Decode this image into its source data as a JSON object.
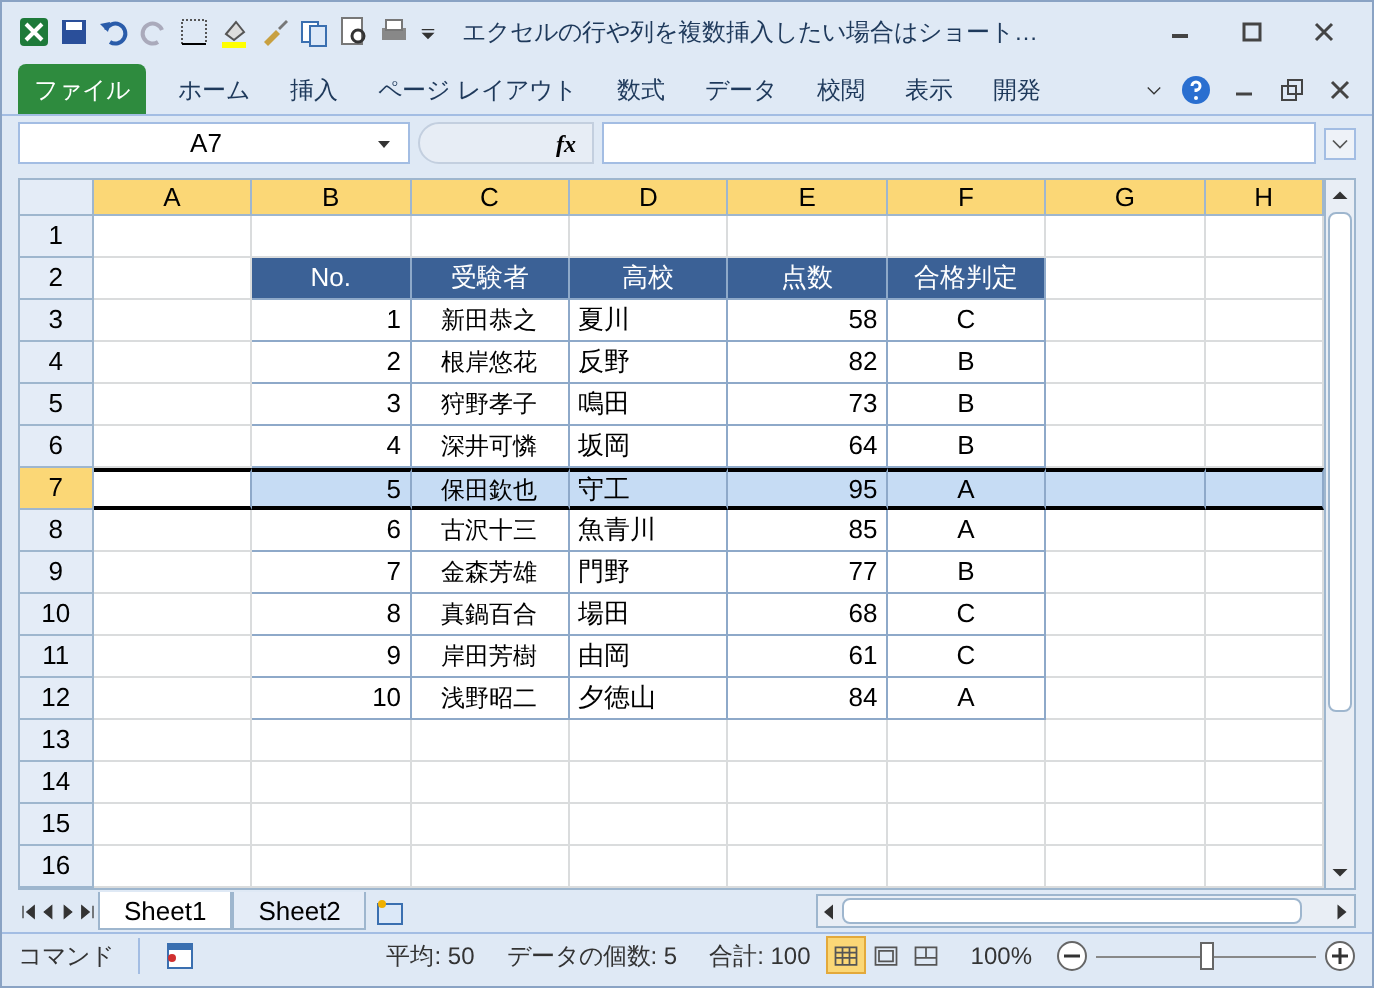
{
  "window": {
    "title": "エクセルの行や列を複数挿入したい場合はショート…"
  },
  "ribbon_tabs": [
    {
      "label": "ファイル",
      "kind": "file",
      "selected": false
    },
    {
      "label": "ホーム",
      "kind": "tab",
      "selected": false
    },
    {
      "label": "挿入",
      "kind": "tab",
      "selected": false
    },
    {
      "label": "ページ レイアウト",
      "kind": "tab",
      "selected": false
    },
    {
      "label": "数式",
      "kind": "tab",
      "selected": false
    },
    {
      "label": "データ",
      "kind": "tab",
      "selected": false
    },
    {
      "label": "校閲",
      "kind": "tab",
      "selected": false
    },
    {
      "label": "表示",
      "kind": "tab",
      "selected": false
    },
    {
      "label": "開発",
      "kind": "tab",
      "selected": false
    }
  ],
  "formula_bar": {
    "name_box": "A7",
    "function_label": "fx"
  },
  "columns": [
    {
      "label": "A",
      "selected": true
    },
    {
      "label": "B",
      "selected": true
    },
    {
      "label": "C",
      "selected": true
    },
    {
      "label": "D",
      "selected": true
    },
    {
      "label": "E",
      "selected": true
    },
    {
      "label": "F",
      "selected": true
    },
    {
      "label": "G",
      "selected": true
    },
    {
      "label": "H",
      "selected": true
    }
  ],
  "rows": [
    {
      "label": "1",
      "selected": false
    },
    {
      "label": "2",
      "selected": false,
      "kind": "header",
      "cells": [
        "No.",
        "受験者",
        "高校",
        "点数",
        "合格判定"
      ]
    },
    {
      "label": "3",
      "selected": false,
      "kind": "data",
      "cells": [
        "1",
        "新田恭之",
        "夏川",
        "58",
        "C"
      ]
    },
    {
      "label": "4",
      "selected": false,
      "kind": "data",
      "cells": [
        "2",
        "根岸悠花",
        "反野",
        "82",
        "B"
      ]
    },
    {
      "label": "5",
      "selected": false,
      "kind": "data",
      "cells": [
        "3",
        "狩野孝子",
        "鳴田",
        "73",
        "B"
      ]
    },
    {
      "label": "6",
      "selected": false,
      "kind": "data",
      "cells": [
        "4",
        "深井可憐",
        "坂岡",
        "64",
        "B"
      ]
    },
    {
      "label": "7",
      "selected": true,
      "kind": "data",
      "cells": [
        "5",
        "保田欽也",
        "守工",
        "95",
        "A"
      ]
    },
    {
      "label": "8",
      "selected": false,
      "kind": "data",
      "cells": [
        "6",
        "古沢十三",
        "魚青川",
        "85",
        "A"
      ]
    },
    {
      "label": "9",
      "selected": false,
      "kind": "data",
      "cells": [
        "7",
        "金森芳雄",
        "門野",
        "77",
        "B"
      ]
    },
    {
      "label": "10",
      "selected": false,
      "kind": "data",
      "cells": [
        "8",
        "真鍋百合",
        "場田",
        "68",
        "C"
      ]
    },
    {
      "label": "11",
      "selected": false,
      "kind": "data",
      "cells": [
        "9",
        "岸田芳樹",
        "由岡",
        "61",
        "C"
      ]
    },
    {
      "label": "12",
      "selected": false,
      "kind": "data",
      "cells": [
        "10",
        "浅野昭二",
        "夕徳山",
        "84",
        "A"
      ]
    },
    {
      "label": "13",
      "selected": false
    },
    {
      "label": "14",
      "selected": false
    },
    {
      "label": "15",
      "selected": false
    },
    {
      "label": "16",
      "selected": false
    }
  ],
  "sheet_tabs": [
    {
      "label": "Sheet1",
      "selected": true
    },
    {
      "label": "Sheet2",
      "selected": false
    }
  ],
  "status_bar": {
    "mode": "コマンド",
    "average": "平均: 50",
    "count": "データの個数: 5",
    "sum": "合計: 100",
    "zoom": "100%",
    "zoom_slider": {
      "level": 0.5
    },
    "views": [
      {
        "kind": "normal",
        "selected": true
      },
      {
        "kind": "layout",
        "selected": false
      },
      {
        "kind": "pagebreak",
        "selected": false
      }
    ]
  }
}
